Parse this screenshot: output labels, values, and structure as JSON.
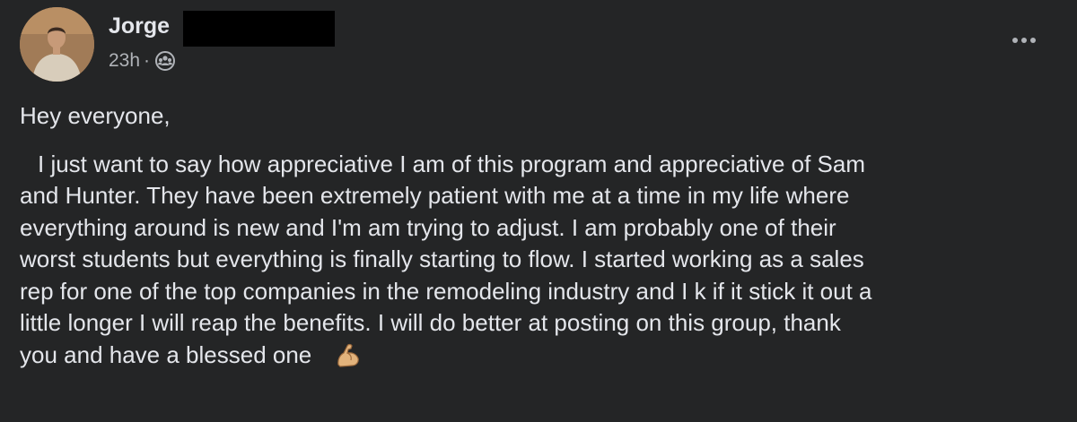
{
  "post": {
    "author_name": "Jorge",
    "time_ago": "23h",
    "meta_separator": "·",
    "audience_icon": "group-icon",
    "more_icon": "more-options-icon",
    "greeting": "Hey everyone,",
    "body": "I just want to say how appreciative I am of this program and appreciative of Sam\nand Hunter. They have been extremely patient with me at a time in my life where\neverything around is new and I'm am trying to adjust. I am probably one of their\nworst students but everything is finally starting to flow. I started working as a sales\nrep for one of the top companies in the remodeling industry and I k if it stick it out a\nlittle longer I will reap the benefits. I will do better at posting on this group, thank\nyou and have a blessed one",
    "emoji": "flexed-biceps-icon"
  },
  "colors": {
    "background": "#242526",
    "primary_text": "#e4e6eb",
    "secondary_text": "#b0b3b8",
    "redaction": "#000000"
  }
}
